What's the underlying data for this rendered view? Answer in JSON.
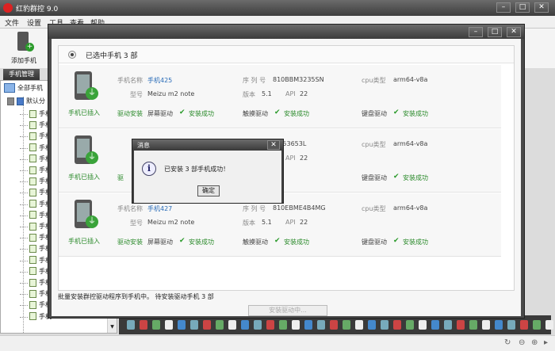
{
  "app": {
    "title": "红豹群控 9.0"
  },
  "menu": [
    "文件",
    "设置",
    "工具",
    "查看",
    "帮助"
  ],
  "toolbar": {
    "add_phone": "添加手机"
  },
  "left": {
    "tab": "手机管理",
    "root": "全部手机",
    "group": "默认分",
    "items": [
      "手机",
      "手机",
      "手机",
      "手机",
      "手机",
      "手机",
      "手机",
      "手机",
      "手机",
      "手机",
      "手机",
      "手机",
      "手机",
      "手机",
      "手机",
      "手机",
      "手机",
      "手机426",
      "手机"
    ]
  },
  "device_window": {
    "selected_label": "已选中手机 3 部",
    "footer": "批量安装群控驱动程序到手机中。 待安装驱动手机 3 部",
    "install_button": "安装驱动中...",
    "devices": [
      {
        "name_key": "手机名称",
        "name": "手机425",
        "serial_key": "序 列 号",
        "serial": "810BBM3235SN",
        "cpu_key": "cpu类型",
        "cpu": "arm64-v8a",
        "model_key": "型号",
        "model": "Meizu m2 note",
        "version_key": "版本",
        "version": "5.1",
        "api_key": "API",
        "api": "22",
        "plugged": "手机已插入",
        "driver_key": "驱动安装",
        "screen_driver": "屏幕驱动",
        "touch_driver": "触摸驱动",
        "keyboard_driver": "键盘驱动",
        "status": "安装成功"
      },
      {
        "name_key": "",
        "name": "",
        "serial_key": "",
        "serial": "BM53653L",
        "cpu_key": "cpu类型",
        "cpu": "arm64-v8a",
        "model_key": "",
        "model": "",
        "version_key": "",
        "version": "",
        "api_key": "API",
        "api": "22",
        "plugged": "手机已插入",
        "driver_key": "驱",
        "screen_driver": "",
        "touch_driver": "",
        "keyboard_driver": "键盘驱动",
        "status": "安装成功"
      },
      {
        "name_key": "手机名称",
        "name": "手机427",
        "serial_key": "序 列 号",
        "serial": "810EBME4B4MG",
        "cpu_key": "cpu类型",
        "cpu": "arm64-v8a",
        "model_key": "型号",
        "model": "Meizu m2 note",
        "version_key": "版本",
        "version": "5.1",
        "api_key": "API",
        "api": "22",
        "plugged": "手机已插入",
        "driver_key": "驱动安装",
        "screen_driver": "屏幕驱动",
        "touch_driver": "触摸驱动",
        "keyboard_driver": "键盘驱动",
        "status": "安装成功"
      }
    ]
  },
  "dialog": {
    "title": "消息",
    "message": "已安装 3 部手机成功！",
    "ok": "确定"
  }
}
